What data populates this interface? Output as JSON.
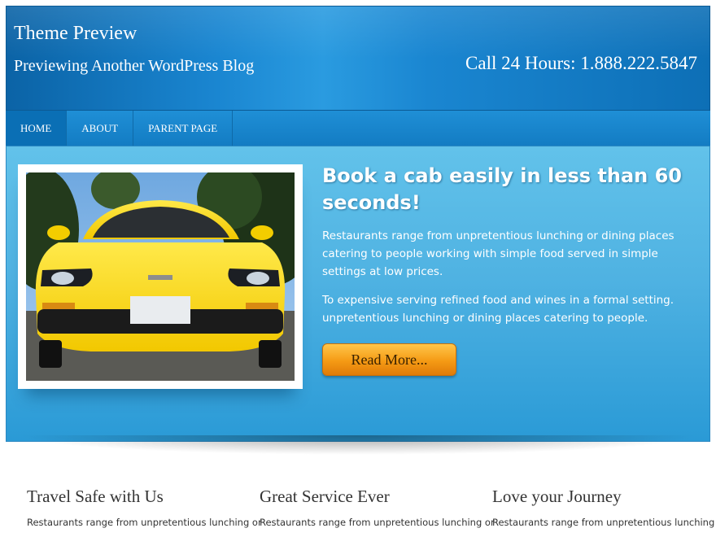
{
  "header": {
    "site_title": "Theme Preview",
    "site_description": "Previewing Another WordPress Blog",
    "phone": "Call 24 Hours: 1.888.222.5847"
  },
  "nav": {
    "items": [
      {
        "label": "HOME",
        "active": true
      },
      {
        "label": "ABOUT",
        "active": false
      },
      {
        "label": "PARENT PAGE",
        "active": false
      }
    ]
  },
  "hero": {
    "title": "Book a cab easily in less than 60 seconds!",
    "paragraph1": "Restaurants range from unpretentious lunching or dining places catering to people working with simple food served in simple settings at low prices.",
    "paragraph2": "To expensive serving refined food and wines in a formal setting. unpretentious lunching or dining places catering to people.",
    "button": "Read More..."
  },
  "columns": [
    {
      "title": "Travel Safe with Us",
      "text": "Restaurants range from unpretentious lunching or"
    },
    {
      "title": "Great Service Ever",
      "text": "Restaurants range from unpretentious lunching or"
    },
    {
      "title": "Love your Journey",
      "text": "Restaurants range from unpretentious lunching or"
    }
  ],
  "colors": {
    "header_blue": "#1a86d1",
    "hero_blue": "#4fb2e2",
    "button_orange": "#f59a14"
  }
}
